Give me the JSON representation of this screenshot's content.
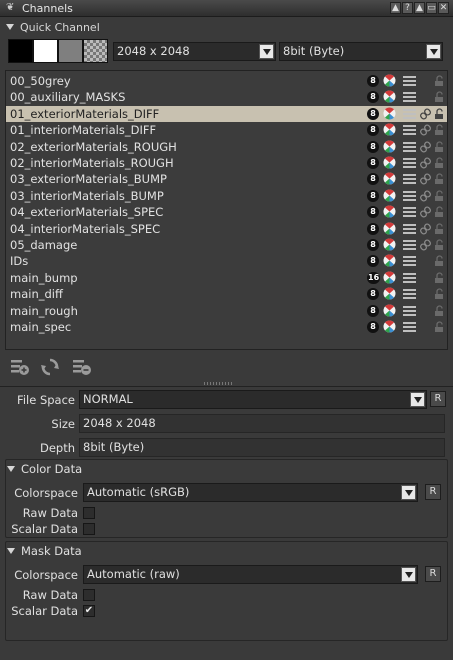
{
  "window": {
    "title": "Channels"
  },
  "title_buttons": [
    "▲",
    "?",
    "▲",
    "▭",
    "✕"
  ],
  "quick_channel": {
    "header": "Quick Channel",
    "size_value": "2048 x 2048",
    "depth_value": "8bit  (Byte)"
  },
  "channels": [
    {
      "name": "00_50grey",
      "depth": "8",
      "linked": false
    },
    {
      "name": "00_auxiliary_MASKS",
      "depth": "8",
      "linked": false
    },
    {
      "name": "01_exteriorMaterials_DIFF",
      "depth": "8",
      "linked": true,
      "selected": true
    },
    {
      "name": "01_interiorMaterials_DIFF",
      "depth": "8",
      "linked": true
    },
    {
      "name": "02_exteriorMaterials_ROUGH",
      "depth": "8",
      "linked": true
    },
    {
      "name": "02_interiorMaterials_ROUGH",
      "depth": "8",
      "linked": true
    },
    {
      "name": "03_exteriorMaterials_BUMP",
      "depth": "8",
      "linked": true
    },
    {
      "name": "03_interiorMaterials_BUMP",
      "depth": "8",
      "linked": true
    },
    {
      "name": "04_exteriorMaterials_SPEC",
      "depth": "8",
      "linked": true
    },
    {
      "name": "04_interiorMaterials_SPEC",
      "depth": "8",
      "linked": true
    },
    {
      "name": "05_damage",
      "depth": "8",
      "linked": true
    },
    {
      "name": "IDs",
      "depth": "8",
      "linked": false
    },
    {
      "name": "main_bump",
      "depth": "16",
      "linked": false
    },
    {
      "name": "main_diff",
      "depth": "8",
      "linked": false
    },
    {
      "name": "main_rough",
      "depth": "8",
      "linked": false
    },
    {
      "name": "main_spec",
      "depth": "8",
      "linked": false
    }
  ],
  "properties": {
    "file_space_label": "File Space",
    "file_space_value": "NORMAL",
    "size_label": "Size",
    "size_value": "2048 x 2048",
    "depth_label": "Depth",
    "depth_value": "8bit  (Byte)",
    "reset_label": "R"
  },
  "color_data": {
    "header": "Color Data",
    "colorspace_label": "Colorspace",
    "colorspace_value": "Automatic (sRGB)",
    "raw_label": "Raw Data",
    "raw_checked": false,
    "scalar_label": "Scalar Data",
    "scalar_checked": false
  },
  "mask_data": {
    "header": "Mask Data",
    "colorspace_label": "Colorspace",
    "colorspace_value": "Automatic (raw)",
    "raw_label": "Raw Data",
    "raw_checked": false,
    "scalar_label": "Scalar Data",
    "scalar_checked": true
  },
  "colors": {
    "background": "#3a3a3a",
    "selected_row": "#c8c1b0",
    "depth_badge": "#111111"
  }
}
